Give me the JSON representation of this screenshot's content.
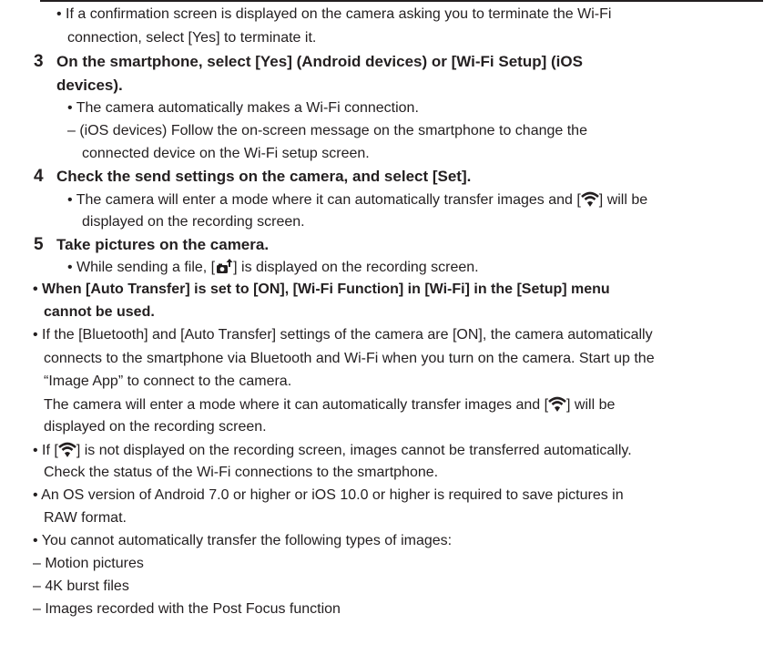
{
  "lines": {
    "l1": "• If a confirmation screen is displayed on the camera asking you to terminate the Wi-Fi",
    "l2": "connection, select [Yes] to terminate it.",
    "step3_num": "3",
    "step3_a": "On the smartphone, select [Yes] (Android devices) or [Wi-Fi Setup] (iOS",
    "step3_b": "devices).",
    "s3_bullet": "• The camera automatically makes a Wi-Fi connection.",
    "s3_dash_a": "– (iOS devices) Follow the on-screen message on the smartphone to change the",
    "s3_dash_b": "connected device on the Wi-Fi setup screen.",
    "step4_num": "4",
    "step4": "Check the send settings on the camera, and select [Set].",
    "s4_a_pre": "• The camera will enter a mode where it can automatically transfer images and [",
    "s4_a_post": "] will be",
    "s4_b": "displayed on the recording screen.",
    "step5_num": "5",
    "step5": "Take pictures on the camera.",
    "s5_pre": "• While sending a file, [",
    "s5_post": "] is displayed on the recording screen.",
    "n1_a": "• When [Auto Transfer] is set to [ON], [Wi-Fi Function] in [Wi-Fi] in the [Setup] menu",
    "n1_b": "cannot be used.",
    "n2_a": "• If the [Bluetooth] and [Auto Transfer] settings of the camera are [ON], the camera automatically",
    "n2_b": "connects to the smartphone via Bluetooth and Wi-Fi when you turn on the camera. Start up the",
    "n2_c": "“Image App” to connect to the camera.",
    "n2_d_pre": "The camera will enter a mode where it can automatically transfer images and [",
    "n2_d_post": "] will be",
    "n2_e": "displayed on the recording screen.",
    "n3_a_pre": "• If [",
    "n3_a_post": "] is not displayed on the recording screen, images cannot be transferred automatically.",
    "n3_b": "Check the status of the Wi-Fi connections to the smartphone.",
    "n4_a": "• An OS version of Android 7.0 or higher or iOS 10.0 or higher is required to save pictures in",
    "n4_b": "RAW format.",
    "n5": "• You cannot automatically transfer the following types of images:",
    "d1": "– Motion pictures",
    "d2": "– 4K burst files",
    "d3": "– Images recorded with the Post Focus function"
  },
  "icons": {
    "wifi": "wifi-icon",
    "transfer": "camera-upload-icon"
  }
}
